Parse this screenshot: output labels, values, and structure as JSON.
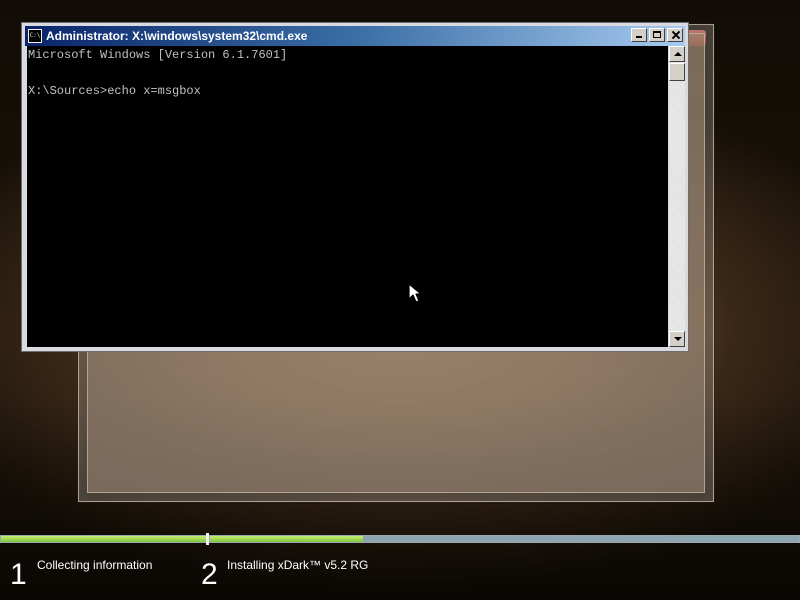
{
  "cmd_window": {
    "title": "Administrator: X:\\windows\\system32\\cmd.exe",
    "app_icon_text": "C:\\",
    "icon": "command-prompt-icon",
    "lines": [
      "Microsoft Windows [Version 6.1.7601]",
      "",
      "X:\\Sources>echo x=msgbox"
    ],
    "buttons": [
      {
        "name": "minimize-button",
        "icon": "minimize-icon"
      },
      {
        "name": "maximize-button",
        "icon": "maximize-icon"
      },
      {
        "name": "close-button",
        "icon": "close-icon"
      }
    ]
  },
  "setup_progress": {
    "steps": [
      {
        "number": "1",
        "label": "Collecting information",
        "progress": 1.0
      },
      {
        "number": "2",
        "label": "Installing xDark™ v5.2 RG",
        "progress": 0.26
      }
    ],
    "colors": {
      "complete": "#a9dc54",
      "track": "#8da5b0"
    }
  }
}
